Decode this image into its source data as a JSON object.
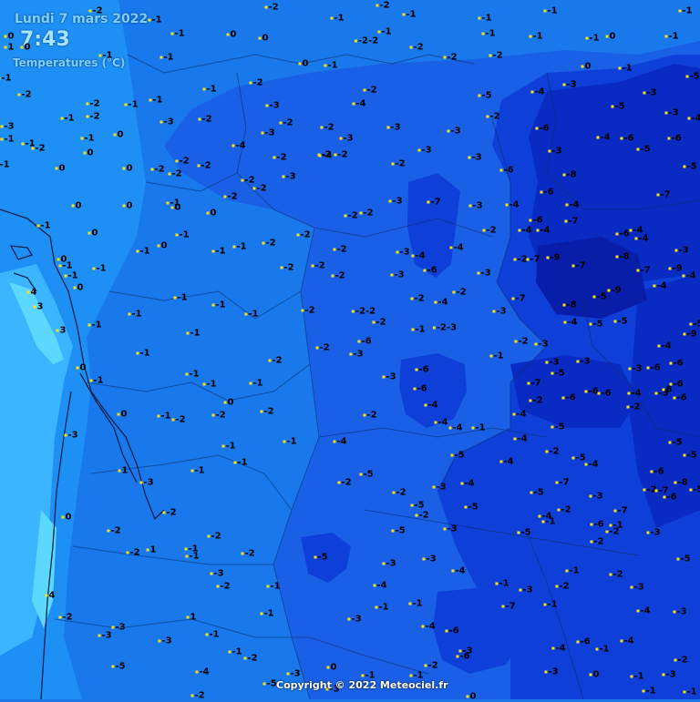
{
  "header": {
    "date": "Lundi 7 mars 2022",
    "time": "7:43",
    "legend": "Temperatures (°C)"
  },
  "footer": {
    "copyright": "Copyright © 2022 Meteociel.fr"
  },
  "colors": {
    "zone_1": "#3bb5ff",
    "zone_0": "#1e90f5",
    "zone_m1": "#1878ec",
    "zone_m3": "#1a60e6",
    "zone_m5": "#0e3fd8",
    "zone_m7": "#0a2ac4",
    "zone_m9": "#081da8",
    "coast_light": "#5cd8ff",
    "label_text": "#000000",
    "label_dot": "#f7e21a"
  },
  "stations": [
    [
      "-2",
      105,
      12
    ],
    [
      "-1",
      170,
      22
    ],
    [
      "-2",
      298,
      8
    ],
    [
      "-1",
      370,
      20
    ],
    [
      "-2",
      420,
      6
    ],
    [
      "-1",
      449,
      16
    ],
    [
      "-1",
      532,
      20
    ],
    [
      "-1",
      604,
      12
    ],
    [
      "-1",
      752,
      12
    ],
    [
      "0",
      10,
      40
    ],
    [
      "1",
      10,
      52
    ],
    [
      "0",
      28,
      52
    ],
    [
      "-1",
      195,
      37
    ],
    [
      "0",
      254,
      38
    ],
    [
      "0",
      289,
      42
    ],
    [
      "-2-2",
      402,
      45
    ],
    [
      "-1",
      422,
      35
    ],
    [
      "-2",
      457,
      52
    ],
    [
      "-1",
      536,
      37
    ],
    [
      "-1",
      588,
      40
    ],
    [
      "-1",
      650,
      42
    ],
    [
      "0",
      670,
      40
    ],
    [
      "-1",
      737,
      40
    ],
    [
      "-1",
      116,
      61
    ],
    [
      "-1",
      183,
      63
    ],
    [
      "0",
      333,
      70
    ],
    [
      "-1",
      363,
      72
    ],
    [
      "-2",
      494,
      63
    ],
    [
      "-2",
      544,
      61
    ],
    [
      "0",
      643,
      73
    ],
    [
      "-1",
      686,
      75
    ],
    [
      "-5",
      760,
      84
    ],
    [
      "-1",
      5,
      86
    ],
    [
      "-2",
      281,
      91
    ],
    [
      "-3",
      625,
      93
    ],
    [
      "-1",
      230,
      98
    ],
    [
      "-2",
      406,
      99
    ],
    [
      "-5",
      532,
      105
    ],
    [
      "-4",
      590,
      101
    ],
    [
      "-3",
      713,
      102
    ],
    [
      "-2",
      27,
      104
    ],
    [
      "-2",
      102,
      114
    ],
    [
      "-1",
      144,
      115
    ],
    [
      "-1",
      171,
      110
    ],
    [
      "-3",
      299,
      116
    ],
    [
      "-4",
      394,
      114
    ],
    [
      "-5",
      678,
      117
    ],
    [
      "-3",
      737,
      124
    ],
    [
      "-4",
      762,
      130
    ],
    [
      "-1",
      74,
      130
    ],
    [
      "-2",
      102,
      128
    ],
    [
      "-2",
      225,
      131
    ],
    [
      "-3",
      183,
      134
    ],
    [
      "-2",
      314,
      135
    ],
    [
      "-2",
      359,
      140
    ],
    [
      "-3",
      432,
      140
    ],
    [
      "-3",
      498,
      144
    ],
    [
      "-2",
      541,
      128
    ],
    [
      "-6",
      595,
      141
    ],
    [
      "-6",
      740,
      152
    ],
    [
      "-3",
      8,
      139
    ],
    [
      "-1",
      96,
      152
    ],
    [
      "0",
      130,
      148
    ],
    [
      "-4",
      262,
      160
    ],
    [
      "-3",
      294,
      146
    ],
    [
      "-3",
      380,
      152
    ],
    [
      "-4",
      662,
      151
    ],
    [
      "-6",
      688,
      152
    ],
    [
      "-5",
      706,
      164
    ],
    [
      "-1",
      8,
      153
    ],
    [
      "-1",
      31,
      158
    ],
    [
      "-2",
      42,
      163
    ],
    [
      "0",
      97,
      168
    ],
    [
      "-3",
      466,
      165
    ],
    [
      "-3",
      609,
      166
    ],
    [
      "-2",
      356,
      170
    ],
    [
      "-4",
      357,
      171
    ],
    [
      "-2",
      374,
      170
    ],
    [
      "-3",
      521,
      173
    ],
    [
      "0",
      66,
      185
    ],
    [
      "-1",
      3,
      181
    ],
    [
      "0",
      140,
      185
    ],
    [
      "-2",
      173,
      186
    ],
    [
      "-2",
      200,
      177
    ],
    [
      "-2",
      192,
      191
    ],
    [
      "-2",
      224,
      182
    ],
    [
      "-2",
      307,
      173
    ],
    [
      "-2",
      437,
      180
    ],
    [
      "-6",
      556,
      187
    ],
    [
      "-8",
      625,
      192
    ],
    [
      "-5",
      757,
      183
    ],
    [
      "-2",
      272,
      198
    ],
    [
      "-3",
      317,
      194
    ],
    [
      "-2",
      285,
      207
    ],
    [
      "-6",
      600,
      211
    ],
    [
      "-4",
      628,
      225
    ],
    [
      "-7",
      728,
      214
    ],
    [
      "0",
      84,
      226
    ],
    [
      "0",
      140,
      226
    ],
    [
      "-1",
      190,
      223
    ],
    [
      "0",
      193,
      228
    ],
    [
      "-2",
      253,
      216
    ],
    [
      "-3",
      434,
      221
    ],
    [
      "-7",
      476,
      222
    ],
    [
      "-3",
      522,
      226
    ],
    [
      "-4",
      562,
      225
    ],
    [
      "0",
      232,
      234
    ],
    [
      "-2",
      385,
      237
    ],
    [
      "-2",
      402,
      234
    ],
    [
      "-6",
      588,
      242
    ],
    [
      "-7",
      627,
      243
    ],
    [
      "-1",
      48,
      248
    ],
    [
      "0",
      102,
      256
    ],
    [
      "-2",
      333,
      258
    ],
    [
      "-2",
      537,
      253
    ],
    [
      "-4",
      576,
      253
    ],
    [
      "-4",
      596,
      253
    ],
    [
      "-6",
      683,
      257
    ],
    [
      "-4",
      698,
      253
    ],
    [
      "-4",
      704,
      262
    ],
    [
      "-1",
      200,
      258
    ],
    [
      "-1",
      157,
      276
    ],
    [
      "0",
      178,
      270
    ],
    [
      "-1",
      240,
      276
    ],
    [
      "-1",
      263,
      271
    ],
    [
      "-2",
      295,
      267
    ],
    [
      "-2",
      373,
      274
    ],
    [
      "-3",
      442,
      277
    ],
    [
      "-4",
      459,
      281
    ],
    [
      "-4",
      501,
      272
    ],
    [
      "-3",
      748,
      275
    ],
    [
      "0",
      68,
      285
    ],
    [
      "-1",
      72,
      292
    ],
    [
      "-1",
      78,
      303
    ],
    [
      "-1",
      109,
      295
    ],
    [
      "-2",
      315,
      294
    ],
    [
      "-2",
      349,
      292
    ],
    [
      "-2",
      371,
      303
    ],
    [
      "-3",
      436,
      302
    ],
    [
      "-6",
      472,
      297
    ],
    [
      "-3",
      531,
      300
    ],
    [
      "-2",
      571,
      285
    ],
    [
      "-7",
      585,
      285
    ],
    [
      "-9",
      607,
      283
    ],
    [
      "-7",
      635,
      292
    ],
    [
      "-8",
      683,
      282
    ],
    [
      "-7",
      706,
      297
    ],
    [
      "-9",
      741,
      295
    ],
    [
      "-4",
      756,
      303
    ],
    [
      "0",
      86,
      316
    ],
    [
      "-4",
      724,
      314
    ],
    [
      "-1",
      198,
      327
    ],
    [
      "-1",
      240,
      335
    ],
    [
      "-2",
      458,
      328
    ],
    [
      "-4",
      484,
      332
    ],
    [
      "-2",
      504,
      321
    ],
    [
      "-7",
      569,
      328
    ],
    [
      "-8",
      625,
      335
    ],
    [
      "-5",
      658,
      326
    ],
    [
      "-9",
      674,
      319
    ],
    [
      "4",
      35,
      321
    ],
    [
      "3",
      42,
      337
    ],
    [
      "-1",
      148,
      345
    ],
    [
      "-1",
      276,
      345
    ],
    [
      "-2",
      338,
      341
    ],
    [
      "-2-2",
      399,
      342
    ],
    [
      "-2",
      416,
      354
    ],
    [
      "-3",
      548,
      342
    ],
    [
      "-4",
      626,
      354
    ],
    [
      "-5",
      654,
      356
    ],
    [
      "-5",
      681,
      353
    ],
    [
      "-5",
      764,
      356
    ],
    [
      "-1",
      104,
      357
    ],
    [
      "-1",
      212,
      366
    ],
    [
      "-1",
      459,
      362
    ],
    [
      "-2-3",
      488,
      360
    ],
    [
      "-9",
      757,
      367
    ],
    [
      "3",
      67,
      363
    ],
    [
      "-6",
      400,
      375
    ],
    [
      "-2",
      354,
      382
    ],
    [
      "-3",
      391,
      389
    ],
    [
      "-2",
      572,
      375
    ],
    [
      "-3",
      594,
      378
    ],
    [
      "-4",
      729,
      380
    ],
    [
      "-1",
      157,
      388
    ],
    [
      "-2",
      302,
      396
    ],
    [
      "-1",
      545,
      391
    ],
    [
      "-3",
      606,
      398
    ],
    [
      "-3",
      640,
      397
    ],
    [
      "-3",
      697,
      405
    ],
    [
      "-6",
      717,
      404
    ],
    [
      "-6",
      742,
      399
    ],
    [
      "0",
      89,
      404
    ],
    [
      "-1",
      211,
      411
    ],
    [
      "-6",
      463,
      406
    ],
    [
      "-3",
      427,
      414
    ],
    [
      "-5",
      612,
      410
    ],
    [
      "-7",
      586,
      421
    ],
    [
      "-6",
      624,
      437
    ],
    [
      "-6",
      649,
      430
    ],
    [
      "-6",
      663,
      432
    ],
    [
      "-4",
      696,
      432
    ],
    [
      "-5",
      726,
      432
    ],
    [
      "-6",
      742,
      422
    ],
    [
      "8",
      732,
      428
    ],
    [
      "-6",
      746,
      437
    ],
    [
      "-1",
      106,
      418
    ],
    [
      "-1",
      230,
      422
    ],
    [
      "-1",
      281,
      421
    ],
    [
      "-6",
      461,
      427
    ],
    [
      "-4",
      473,
      445
    ],
    [
      "0",
      251,
      442
    ],
    [
      "-2",
      240,
      456
    ],
    [
      "-2",
      293,
      452
    ],
    [
      "-2",
      695,
      447
    ],
    [
      "-2",
      588,
      440
    ],
    [
      "0",
      134,
      455
    ],
    [
      "-1",
      180,
      457
    ],
    [
      "-2",
      196,
      461
    ],
    [
      "-2",
      406,
      456
    ],
    [
      "-4",
      484,
      464
    ],
    [
      "-4",
      500,
      470
    ],
    [
      "-1",
      525,
      470
    ],
    [
      "-4",
      570,
      455
    ],
    [
      "-5",
      612,
      469
    ],
    [
      "-1",
      251,
      490
    ],
    [
      "-1",
      318,
      485
    ],
    [
      "-4",
      373,
      485
    ],
    [
      "-3",
      78,
      478
    ],
    [
      "-4",
      571,
      482
    ],
    [
      "-2",
      606,
      496
    ],
    [
      "-5",
      741,
      486
    ],
    [
      "-5",
      757,
      500
    ],
    [
      "-1",
      264,
      508
    ],
    [
      "-5",
      502,
      500
    ],
    [
      "-4",
      556,
      507
    ],
    [
      "-5",
      635,
      503
    ],
    [
      "-4",
      649,
      510
    ],
    [
      "-6",
      721,
      518
    ],
    [
      "-8",
      747,
      530
    ],
    [
      "1",
      135,
      517
    ],
    [
      "-1",
      217,
      517
    ],
    [
      "-5",
      402,
      521
    ],
    [
      "-2",
      378,
      530
    ],
    [
      "-4",
      513,
      531
    ],
    [
      "-5",
      589,
      541
    ],
    [
      "-7",
      617,
      530
    ],
    [
      "-3",
      654,
      545
    ],
    [
      "-2",
      713,
      538
    ],
    [
      "-7",
      726,
      539
    ],
    [
      "-6",
      735,
      546
    ],
    [
      "-5",
      764,
      538
    ],
    [
      "-3",
      161,
      530
    ],
    [
      "-2",
      438,
      541
    ],
    [
      "-5",
      458,
      555
    ],
    [
      "-2",
      463,
      566
    ],
    [
      "-3",
      482,
      535
    ],
    [
      "-5",
      517,
      557
    ],
    [
      "-2",
      619,
      560
    ],
    [
      "-4",
      598,
      567
    ],
    [
      "-1",
      602,
      573
    ],
    [
      "-7",
      681,
      561
    ],
    [
      "-2",
      186,
      563
    ],
    [
      "0",
      73,
      568
    ],
    [
      "-2",
      125,
      583
    ],
    [
      "-2",
      235,
      589
    ],
    [
      "-2",
      272,
      608
    ],
    [
      "-5",
      437,
      583
    ],
    [
      "-3",
      494,
      581
    ],
    [
      "-5",
      575,
      585
    ],
    [
      "-6",
      655,
      576
    ],
    [
      "-1",
      676,
      577
    ],
    [
      "-2",
      672,
      584
    ],
    [
      "-2",
      655,
      595
    ],
    [
      "-2",
      146,
      607
    ],
    [
      "1",
      166,
      604
    ],
    [
      "-1",
      210,
      603
    ],
    [
      "-1",
      211,
      611
    ],
    [
      "-5",
      352,
      612
    ],
    [
      "-3",
      427,
      619
    ],
    [
      "-3",
      471,
      614
    ],
    [
      "-4",
      503,
      627
    ],
    [
      "-3",
      717,
      585
    ],
    [
      "-5",
      750,
      614
    ],
    [
      "-3",
      238,
      630
    ],
    [
      "-2",
      245,
      644
    ],
    [
      "-1",
      300,
      644
    ],
    [
      "-4",
      417,
      643
    ],
    [
      "-1",
      551,
      641
    ],
    [
      "-3",
      577,
      648
    ],
    [
      "-2",
      617,
      644
    ],
    [
      "-1",
      628,
      627
    ],
    [
      "-2",
      676,
      631
    ],
    [
      "-3",
      699,
      645
    ],
    [
      "4",
      55,
      654
    ],
    [
      "-1",
      604,
      664
    ],
    [
      "-7",
      558,
      666
    ],
    [
      "-1",
      419,
      667
    ],
    [
      "-1",
      293,
      674
    ],
    [
      "-4",
      706,
      671
    ],
    [
      "-3",
      746,
      672
    ],
    [
      "-1",
      456,
      663
    ],
    [
      "-2",
      72,
      678
    ],
    [
      "1",
      210,
      678
    ],
    [
      "-3",
      389,
      680
    ],
    [
      "-4",
      470,
      688
    ],
    [
      "-6",
      496,
      693
    ],
    [
      "-3",
      130,
      689
    ],
    [
      "-3",
      115,
      698
    ],
    [
      "-1",
      233,
      697
    ],
    [
      "-3",
      181,
      704
    ],
    [
      "-4",
      613,
      712
    ],
    [
      "-6",
      640,
      705
    ],
    [
      "-1",
      661,
      713
    ],
    [
      "-4",
      688,
      704
    ],
    [
      "-1",
      258,
      716
    ],
    [
      "-2",
      275,
      723
    ],
    [
      "-3",
      511,
      715
    ],
    [
      "-6",
      508,
      721
    ],
    [
      "-5",
      130,
      732
    ],
    [
      "-4",
      222,
      738
    ],
    [
      "0",
      364,
      733
    ],
    [
      "-1",
      404,
      742
    ],
    [
      "-1",
      457,
      742
    ],
    [
      "-3",
      322,
      740
    ],
    [
      "-2",
      473,
      731
    ],
    [
      "-3",
      605,
      738
    ],
    [
      "0",
      652,
      741
    ],
    [
      "-1",
      699,
      743
    ],
    [
      "-3",
      734,
      741
    ],
    [
      "-2",
      747,
      725
    ],
    [
      "-2",
      217,
      764
    ],
    [
      "-5",
      296,
      751
    ],
    [
      "-3",
      365,
      757
    ],
    [
      "0",
      517,
      765
    ],
    [
      "-1",
      712,
      759
    ],
    [
      "-1",
      757,
      760
    ]
  ]
}
